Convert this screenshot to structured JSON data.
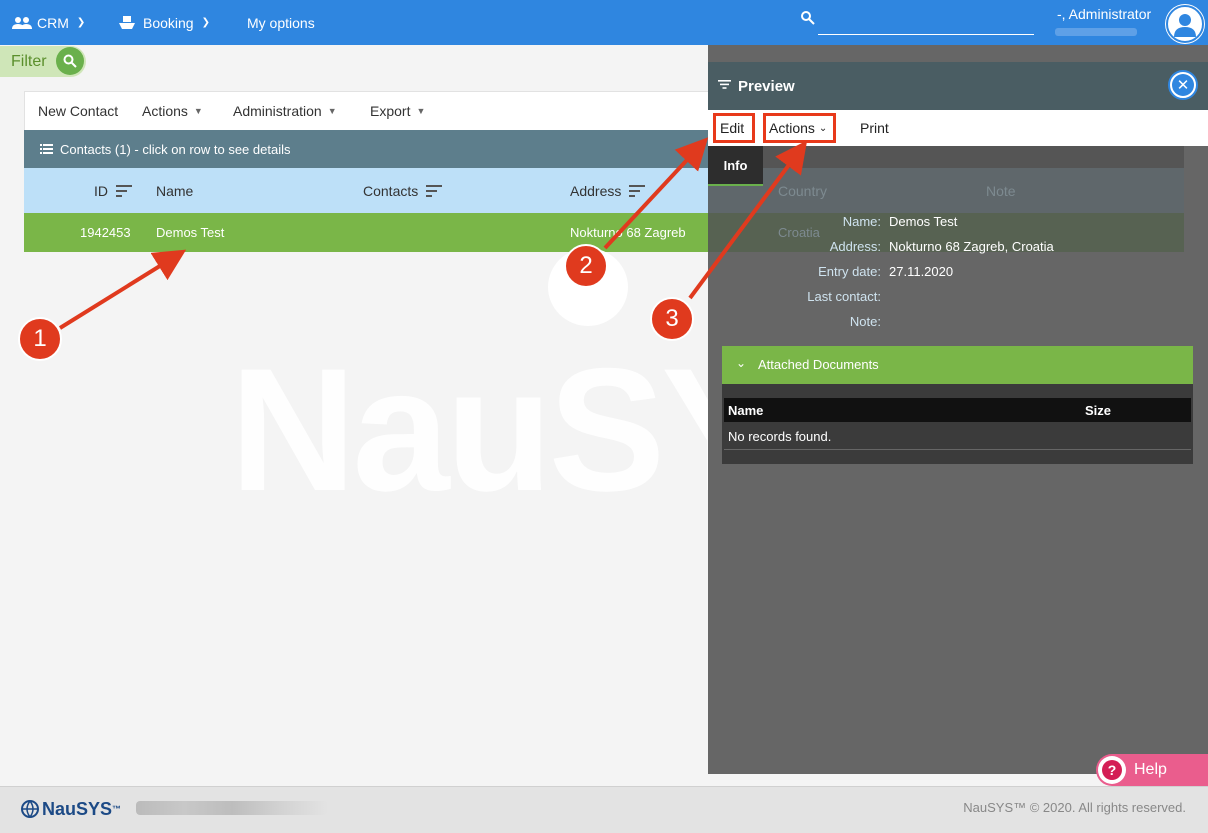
{
  "topbar": {
    "nav": [
      {
        "label": "CRM",
        "icon": "people-icon"
      },
      {
        "label": "Booking",
        "icon": "boat-icon"
      },
      {
        "label": "My options"
      }
    ],
    "search_value": "",
    "user_name": "-, Administrator"
  },
  "filter": {
    "label": "Filter"
  },
  "toolbar": {
    "new_contact": "New Contact",
    "actions": "Actions",
    "administration": "Administration",
    "export": "Export"
  },
  "grid": {
    "title": "Contacts (1) - click on row to see details",
    "columns": [
      "ID",
      "Name",
      "Contacts",
      "Address",
      "Country",
      "Note"
    ],
    "rows": [
      {
        "id": "1942453",
        "name": "Demos Test",
        "contacts": "",
        "address": "Nokturno 68 Zagreb",
        "country": "Croatia",
        "note": ""
      }
    ]
  },
  "watermark": "NauSYS",
  "preview": {
    "title": "Preview",
    "toolbar": {
      "edit": "Edit",
      "actions": "Actions",
      "print": "Print"
    },
    "tab": "Info",
    "fields": [
      {
        "label": "Name:",
        "value": "Demos Test"
      },
      {
        "label": "Address:",
        "value": "Nokturno 68 Zagreb, Croatia"
      },
      {
        "label": "Entry date:",
        "value": "27.11.2020"
      },
      {
        "label": "Last contact:",
        "value": ""
      },
      {
        "label": "Note:",
        "value": ""
      }
    ],
    "attached": {
      "title": "Attached Documents",
      "col_name": "Name",
      "col_size": "Size",
      "empty": "No records found."
    }
  },
  "help": {
    "label": "Help"
  },
  "footer": {
    "logo": "NauSYS",
    "logo_mark": "™",
    "copyright": "NauSYS™ © 2020. All rights reserved."
  },
  "annotations": [
    "1",
    "2",
    "3"
  ],
  "colors": {
    "topbar": "#2f86e0",
    "row_selected": "#7ab648",
    "header_bar": "#5d7e8c",
    "annotation": "#e03a1e",
    "help": "#ea5d8d"
  }
}
